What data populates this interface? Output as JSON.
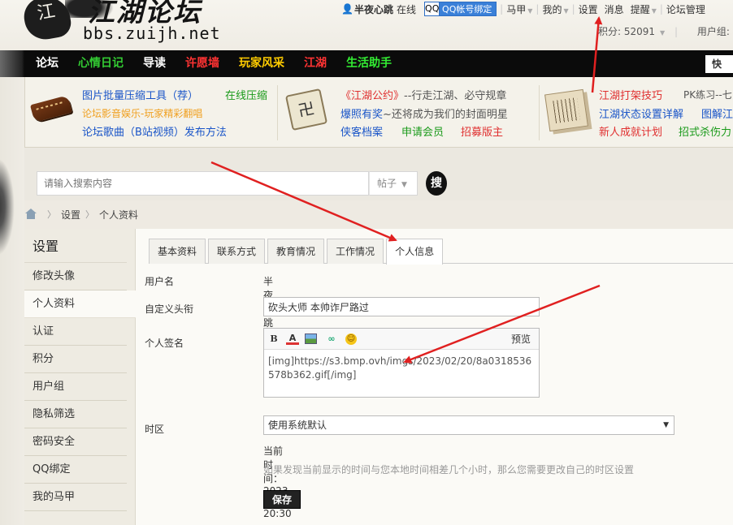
{
  "header": {
    "logo_seal": "江",
    "logo_cn": "江湖论坛",
    "logo_en": "bbs.zuijh.net",
    "username": "半夜心跳",
    "online_status": "在线",
    "qq_bind_label": "QQ帐号绑定",
    "qq_icon_label": "QQ",
    "links": [
      "马甲",
      "我的",
      "设置",
      "消息",
      "提醒",
      "论坛管理"
    ],
    "points": "积分: 52091",
    "usergroup": "用户组: 版主"
  },
  "nav": {
    "items": [
      {
        "label": "论坛",
        "color": "#ffffff"
      },
      {
        "label": "心情日记",
        "color": "#33cc33"
      },
      {
        "label": "导读",
        "color": "#ffffff"
      },
      {
        "label": "许愿墙",
        "color": "#ff3333"
      },
      {
        "label": "玩家风采",
        "color": "#ffcc00"
      },
      {
        "label": "江湖",
        "color": "#ff3333"
      },
      {
        "label": "生活助手",
        "color": "#33ee33"
      }
    ],
    "search_label": "快"
  },
  "banner": {
    "col1": [
      {
        "text": "图片批量压缩工具（荐）",
        "color": "#1a55c8"
      },
      {
        "text": "在线压缩",
        "color": "#1a9a1a"
      },
      {
        "text": "论坛影音娱乐-玩家精彩翻唱",
        "color": "#f0a020"
      },
      {
        "text": "论坛歌曲（B站视频）发布方法",
        "color": "#1a55c8"
      }
    ],
    "col2": [
      {
        "text": "《江湖公约》",
        "color": "#e03030"
      },
      {
        "text": "--行走江湖、必守规章",
        "color": "#555555"
      },
      {
        "text": "爆照有奖",
        "color": "#1a55c8"
      },
      {
        "text": "~还将成为我们的封面明星",
        "color": "#555555"
      },
      {
        "text": "侠客档案",
        "color": "#1a55c8"
      },
      {
        "text": "申请会员",
        "color": "#1a9a1a"
      },
      {
        "text": "招募版主",
        "color": "#e03030"
      }
    ],
    "col3": [
      {
        "text": "江湖打架技巧",
        "color": "#e03030"
      },
      {
        "text": "PK练习--七",
        "color": "#555555"
      },
      {
        "text": "江湖状态设置详解",
        "color": "#1a55c8"
      },
      {
        "text": "图解江",
        "color": "#1a55c8"
      },
      {
        "text": "新人成就计划",
        "color": "#e03030"
      },
      {
        "text": "招式杀伤力",
        "color": "#1a9a1a"
      }
    ]
  },
  "search": {
    "placeholder": "请输入搜索内容",
    "type": "帖子",
    "button": "搜"
  },
  "breadcrumb": [
    "设置",
    "个人资料"
  ],
  "sidebar": {
    "title": "设置",
    "items": [
      "修改头像",
      "个人资料",
      "认证",
      "积分",
      "用户组",
      "隐私筛选",
      "密码安全",
      "QQ绑定",
      "我的马甲"
    ],
    "active_index": 1
  },
  "tabs": [
    "基本资料",
    "联系方式",
    "教育情况",
    "工作情况",
    "个人信息"
  ],
  "form": {
    "username_label": "用户名",
    "username_value": "半夜心跳",
    "motto_label": "自定义头衔",
    "motto_value": "砍头大师 本帅诈尸路过",
    "signature_label": "个人签名",
    "signature_toolbar": {
      "bold": "B",
      "color": "A",
      "link": "∞",
      "smiley": "☺"
    },
    "signature_preview": "预览",
    "signature_value": "[img]https://s3.bmp.ovh/imgs/2023/02/20/8a0318536578b362.gif[/img]",
    "timezone_label": "时区",
    "timezone_value": "使用系统默认",
    "current_time": "当前时间：2023-3-12 20:30",
    "timezone_hint": "如果发现当前显示的时间与您本地时间相差几个小时，那么您需要更改自己的时区设置",
    "save_label": "保存"
  },
  "colors": {
    "nav_bg": "#0b0b0b",
    "page_bg": "#eeeae2",
    "content_bg": "#fbfaf6",
    "arrow": "#e02020"
  }
}
